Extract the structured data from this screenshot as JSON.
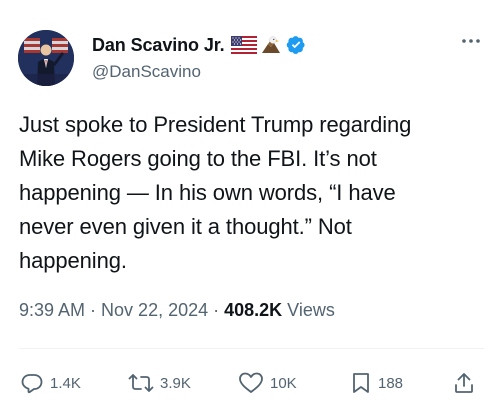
{
  "author": {
    "display_name": "Dan Scavino Jr.",
    "handle": "@DanScavino",
    "verified": true
  },
  "tweet": {
    "lines": [
      "Just spoke to President Trump regarding",
      "Mike Rogers going to the FBI. It’s not",
      "happening — In his own words, “I have",
      "never even given it a thought.” Not",
      "happening."
    ]
  },
  "meta": {
    "time": "9:39 AM",
    "separator": "·",
    "date": "Nov 22, 2024",
    "views_count": "408.2K",
    "views_label": "Views"
  },
  "actions": {
    "replies": "1.4K",
    "reposts": "3.9K",
    "likes": "10K",
    "bookmarks": "188"
  },
  "colors": {
    "text": "#0f1419",
    "secondary": "#536471",
    "verified": "#1d9bf0",
    "divider": "#eff3f4"
  }
}
